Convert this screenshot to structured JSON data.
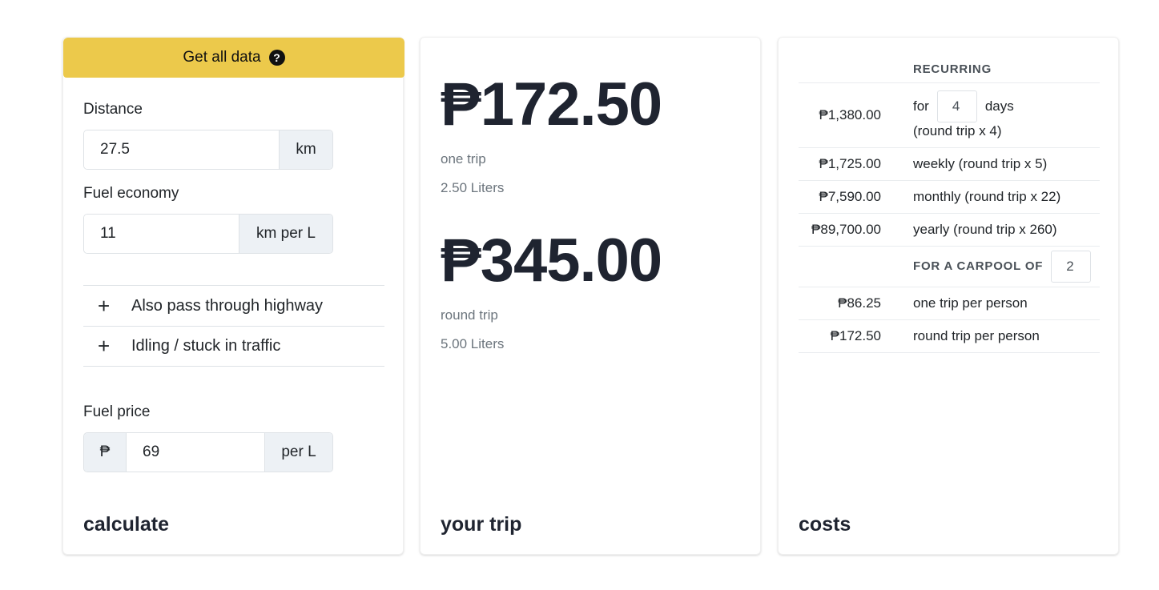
{
  "calculate": {
    "get_data_label": "Get all data",
    "help_icon_glyph": "?",
    "distance": {
      "label": "Distance",
      "value": "27.5",
      "unit": "km"
    },
    "fuel_economy": {
      "label": "Fuel economy",
      "value": "11",
      "unit": "km per L"
    },
    "toggles": [
      {
        "icon": "+",
        "label": "Also pass through highway"
      },
      {
        "icon": "+",
        "label": "Idling / stuck in traffic"
      }
    ],
    "fuel_price": {
      "label": "Fuel price",
      "currency": "₱",
      "value": "69",
      "unit": "per L"
    },
    "title": "calculate",
    "accent_color": "#ecc94b"
  },
  "trip": {
    "one_trip_amount": "₱172.50",
    "one_trip_label": "one trip",
    "one_trip_liters": "2.50 Liters",
    "round_trip_amount": "₱345.00",
    "round_trip_label": "round trip",
    "round_trip_liters": "5.00 Liters",
    "title": "your trip"
  },
  "costs": {
    "recurring_header": "RECURRING",
    "custom_days": {
      "amount": "₱1,380.00",
      "prefix": "for",
      "value": "4",
      "suffix": "days",
      "note": "(round trip x 4)"
    },
    "rows": [
      {
        "amount": "₱1,725.00",
        "label": "weekly (round trip x 5)"
      },
      {
        "amount": "₱7,590.00",
        "label": "monthly (round trip x 22)"
      },
      {
        "amount": "₱89,700.00",
        "label": "yearly (round trip x 260)"
      }
    ],
    "carpool_header": "FOR A CARPOOL OF",
    "carpool_value": "2",
    "carpool_rows": [
      {
        "amount": "₱86.25",
        "label": "one trip per person"
      },
      {
        "amount": "₱172.50",
        "label": "round trip per person"
      }
    ],
    "title": "costs"
  }
}
